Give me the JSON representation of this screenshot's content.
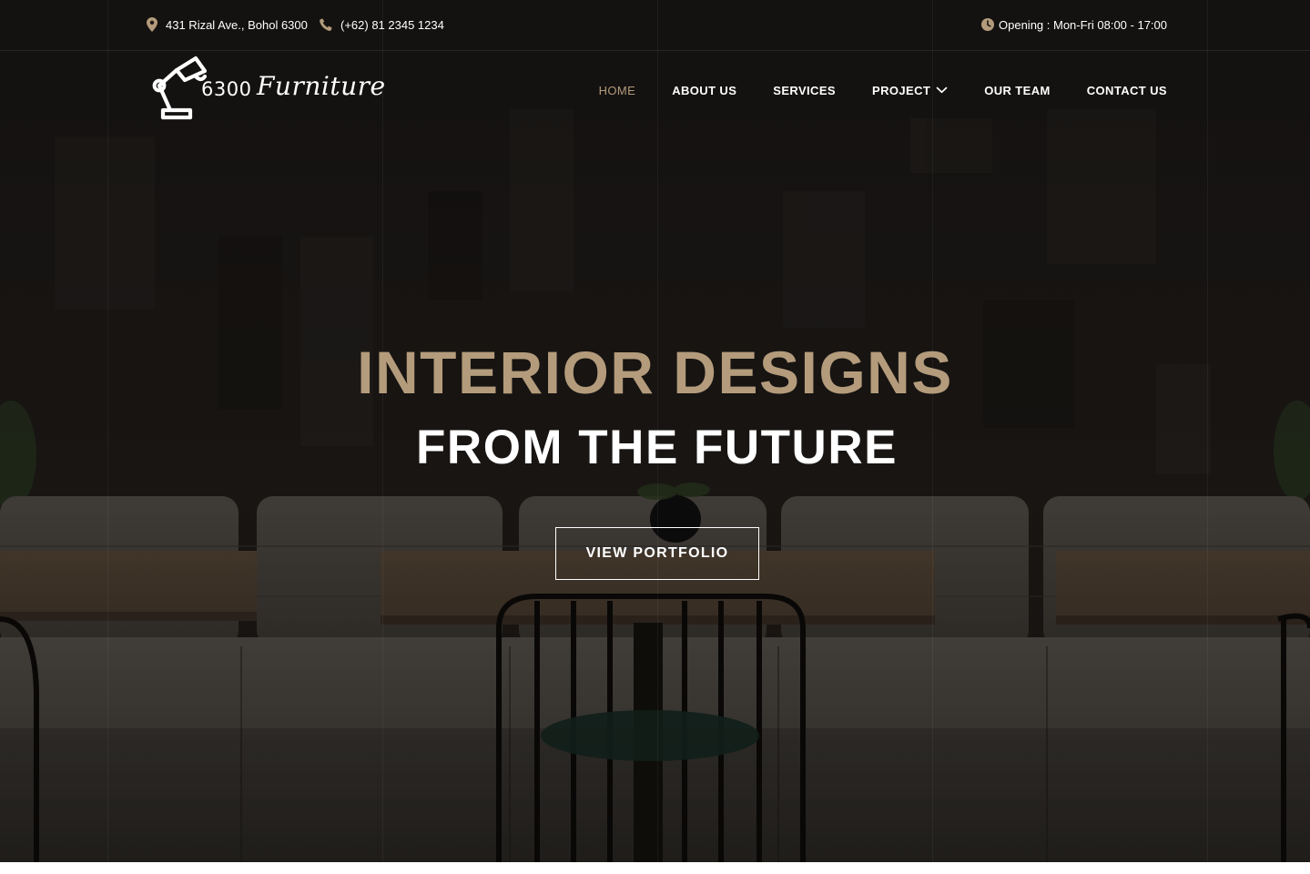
{
  "topbar": {
    "address": "431 Rizal Ave., Bohol 6300",
    "phone": "(+62) 81 2345 1234",
    "hours": "Opening : Mon-Fri 08:00 - 17:00"
  },
  "brand": {
    "number": "6300",
    "word": "Furniture"
  },
  "nav": {
    "items": [
      {
        "label": "HOME"
      },
      {
        "label": "ABOUT US"
      },
      {
        "label": "SERVICES"
      },
      {
        "label": "PROJECT"
      },
      {
        "label": "OUR TEAM"
      },
      {
        "label": "CONTACT US"
      }
    ],
    "active_item": "HOME"
  },
  "hero": {
    "title": "INTERIOR DESIGNS",
    "subtitle": "FROM THE FUTURE",
    "cta_label": "VIEW PORTFOLIO"
  },
  "colors": {
    "accent": "#b39b7b",
    "text": "#ffffff",
    "background": "#1a1715"
  },
  "icons": {
    "address": "map-pin-icon",
    "phone": "phone-icon",
    "hours": "clock-icon",
    "logo": "desk-lamp-icon",
    "dropdown": "chevron-down-icon"
  }
}
